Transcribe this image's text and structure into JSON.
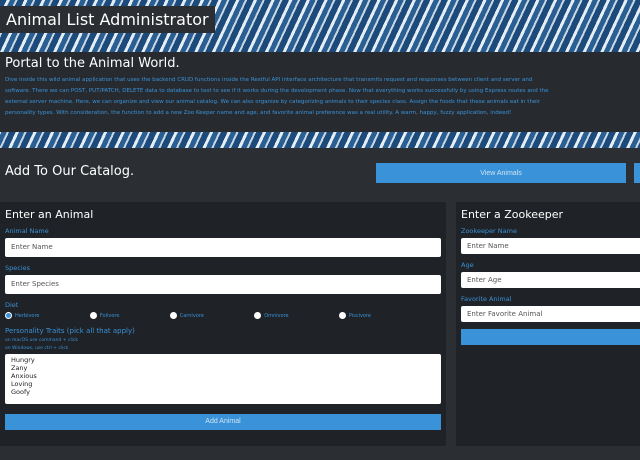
{
  "header": {
    "title": "Animal List Administrator"
  },
  "intro": {
    "heading": "Portal to the Animal World.",
    "lines": [
      "Dive inside this wild animal application that uses the backend CRUD functions inside the Restful API interface architecture that transmits request and responses between client and server and",
      "software. There we can POST, PUT/PATCH, DELETE data to database to test to see if it works during the development phase. Now that everything works successfully by using Express routes and the",
      "external server machine. Here, we can organize and view our animal catalog. We can also organize by categorizing animals to their species class. Assign the foods that these animals eat in their",
      "personality types. With consideration, the function to add a new Zoo Keeper name and age, and favorite animal preference was a real utility. A warm, happy, fuzzy application, indeed!"
    ]
  },
  "catalog": {
    "heading": "Add To Our Catalog.",
    "view_animals": "View Animals"
  },
  "animal_form": {
    "heading": "Enter an Animal",
    "name_label": "Animal Name",
    "name_placeholder": "Enter Name",
    "species_label": "Species",
    "species_placeholder": "Enter Species",
    "diet_label": "Diet",
    "diets": [
      "Herbivore",
      "Folivore",
      "Carnivore",
      "Omnivore",
      "Piscivore"
    ],
    "traits_label": "Personality Traits (pick all that apply)",
    "mac_note": "on macOS use command + click",
    "win_note": "on Windows, use ctrl + click",
    "traits": [
      "Hungry",
      "Zany",
      "Anxious",
      "Loving",
      "Goofy"
    ],
    "submit": "Add Animal"
  },
  "zookeeper_form": {
    "heading": "Enter a Zookeeper",
    "name_label": "Zookeeper Name",
    "name_placeholder": "Enter Name",
    "age_label": "Age",
    "age_placeholder": "Enter Age",
    "fav_label": "Favorite Animal",
    "fav_placeholder": "Enter Favorite Animal"
  }
}
